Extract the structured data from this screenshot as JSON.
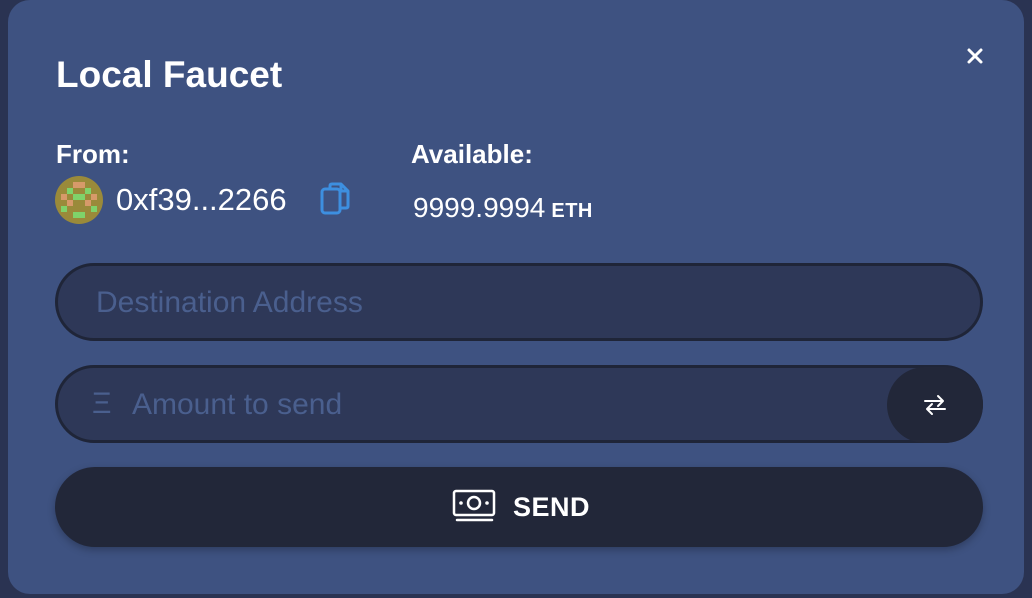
{
  "modal": {
    "title": "Local Faucet",
    "close_icon": "close-icon"
  },
  "from": {
    "label": "From:",
    "address": "0xf39...2266",
    "avatar_icon": "blockie-avatar",
    "copy_icon": "copy-icon"
  },
  "available": {
    "label": "Available:",
    "amount": "9999.9994",
    "unit": "ETH"
  },
  "destination": {
    "placeholder": "Destination Address",
    "value": ""
  },
  "amount": {
    "prefix": "Ξ",
    "placeholder": "Amount to send",
    "value": "",
    "swap_icon": "swap-arrows-icon"
  },
  "send": {
    "label": "SEND",
    "icon": "cash-icon"
  },
  "colors": {
    "modal_bg": "#3e5281",
    "field_bg": "#2e3858",
    "button_bg": "#222739",
    "copy_icon": "#3d8fe0",
    "placeholder": "#4a5f8e"
  }
}
